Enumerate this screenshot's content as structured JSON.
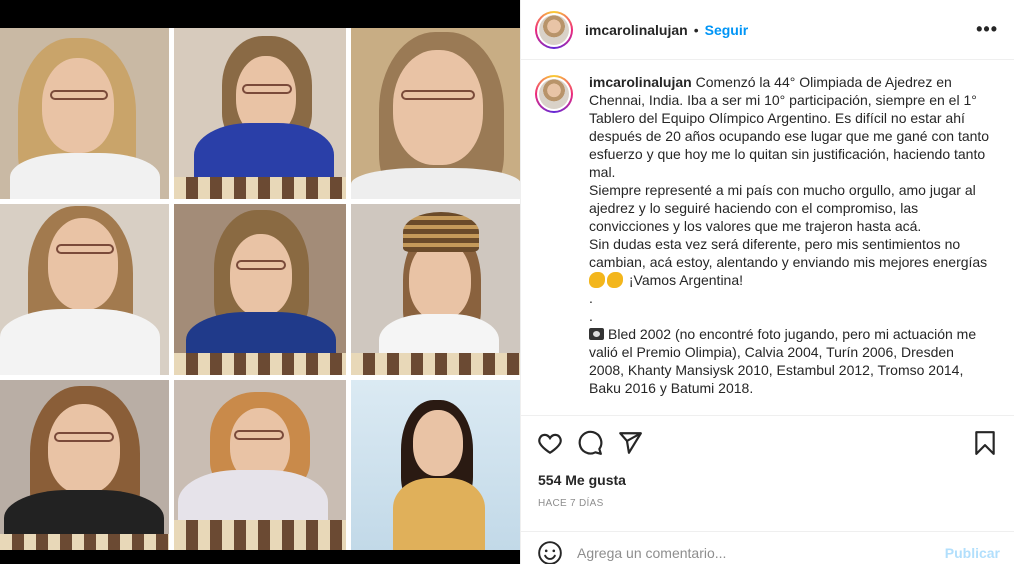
{
  "post": {
    "username": "imcarolinalujan",
    "follow_label": "Seguir",
    "separator": "•",
    "more_label": "•••",
    "caption": "Comenzó la 44° Olimpiada de Ajedrez en Chennai, India. Iba a ser mi 10° participación, siempre en el 1° Tablero del Equipo Olímpico Argentino. Es difícil no estar ahí después de 20 años ocupando ese lugar que me gané con tanto esfuerzo y que hoy me lo quitan sin justificación, haciendo tanto mal.\nSiempre representé a mi país con mucho orgullo, amo jugar al ajedrez y lo seguiré haciendo con el compromiso, las convicciones y los valores que me trajeron hasta acá.\nSin dudas esta vez será diferente, pero mis sentimientos no cambian, acá estoy, alentando y enviando mis mejores energías",
    "caption_cheer": "¡Vamos Argentina!",
    "caption_dot1": ".",
    "caption_dot2": ".",
    "caption_footer": "Bled 2002 (no encontré foto jugando, pero mi actuación me valió el Premio Olimpia), Calvia 2004, Turín 2006, Dresden 2008, Khanty Mansiysk 2010, Estambul 2012, Tromso 2014, Baku 2016 y Batumi 2018.",
    "likes": "554 Me gusta",
    "time": "HACE 7 DÍAS"
  },
  "comment": {
    "placeholder": "Agrega un comentario...",
    "publish_label": "Publicar"
  },
  "icons": {
    "like": "heart-icon",
    "comment": "comment-icon",
    "share": "share-icon",
    "save": "bookmark-icon",
    "emoji": "smiley-icon",
    "muscle": "flexed-biceps-icon",
    "camera": "camera-icon"
  },
  "colors": {
    "accent": "#0095f6",
    "publish_disabled": "#b2dffc",
    "muted": "#8e8e8e"
  }
}
